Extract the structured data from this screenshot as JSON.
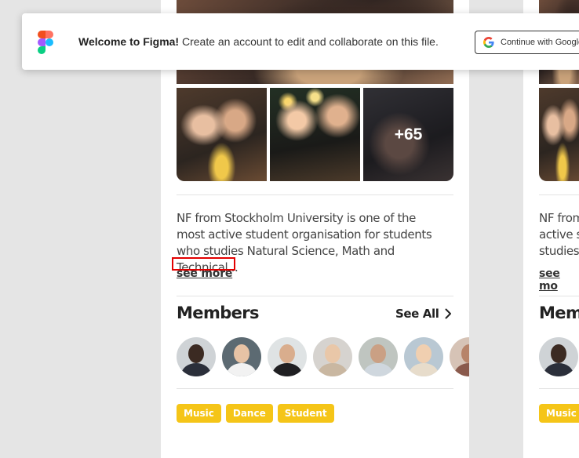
{
  "banner": {
    "welcome_bold": "Welcome to Figma!",
    "welcome_rest": " Create an account to edit and collaborate on this file.",
    "google_button": "Continue with Google"
  },
  "gallery": {
    "more_count": "+65"
  },
  "community": {
    "description": "NF from Stockholm University is one of the most active student organisation for students who studies Natural Science, Math and Technical...",
    "see_more": "see more",
    "members_title": "Members",
    "see_all": "See All",
    "tags": [
      "Music",
      "Dance",
      "Student"
    ]
  },
  "right_preview": {
    "lines": [
      "NF from S",
      "active s",
      "studies"
    ],
    "see_more": "see mo",
    "members_title": "Mem",
    "tag": "Music"
  },
  "colors": {
    "tag_bg": "#f5c518",
    "highlight": "#e30000"
  }
}
